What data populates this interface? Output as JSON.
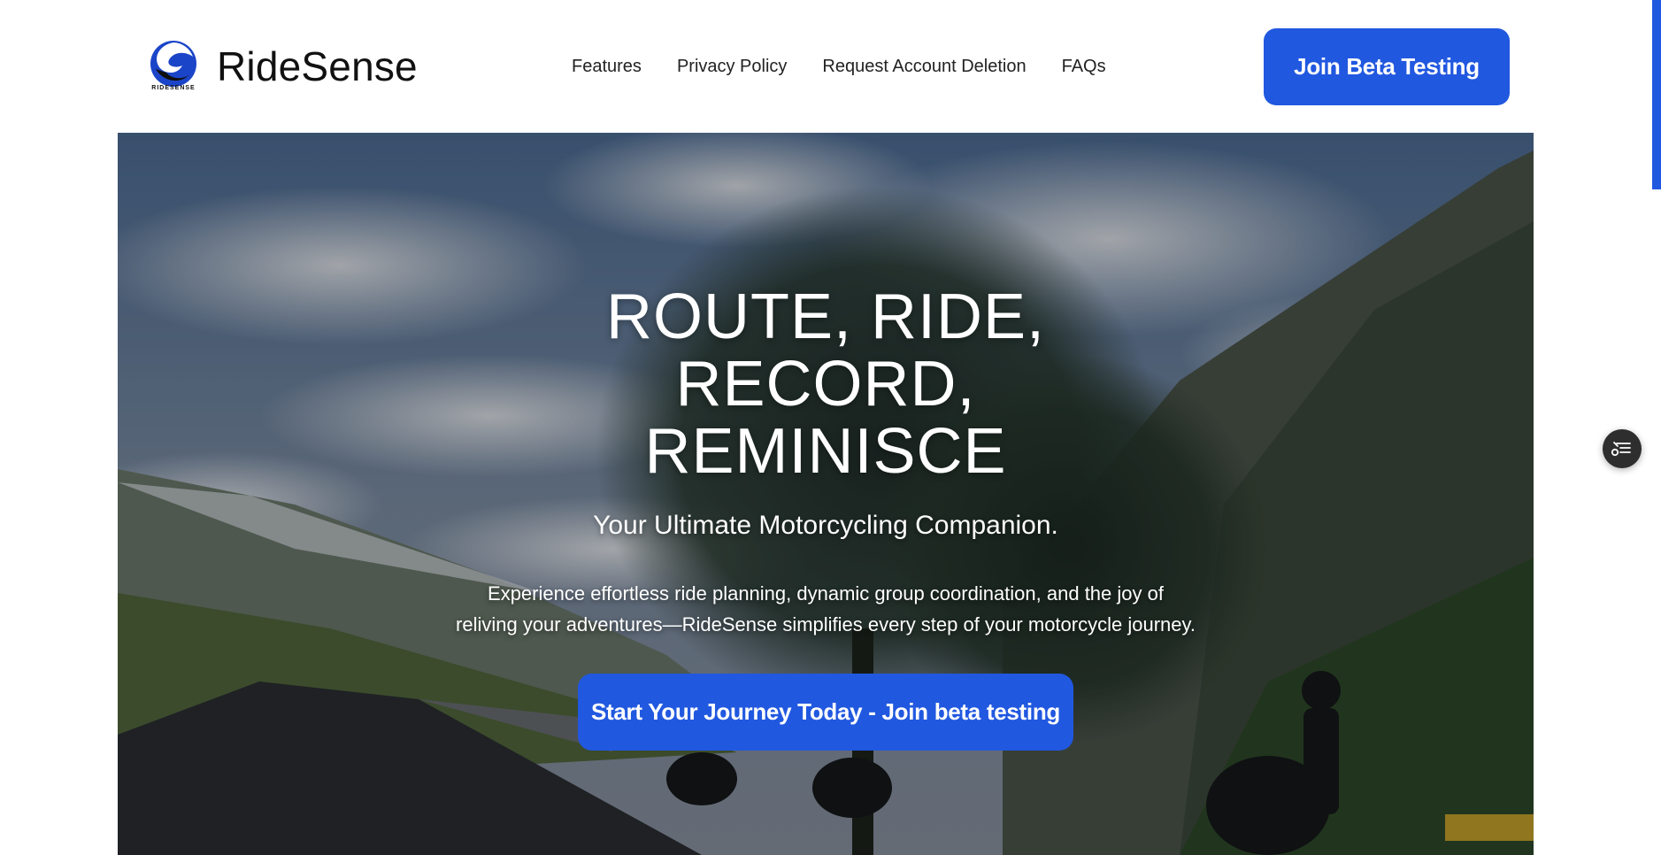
{
  "header": {
    "logo_icon": "ridesense-swirl-logo",
    "logo_small_text": "RIDESENSE",
    "brand_name": "RideSense",
    "nav": [
      {
        "label": "Features"
      },
      {
        "label": "Privacy Policy"
      },
      {
        "label": "Request Account Deletion"
      },
      {
        "label": "FAQs"
      }
    ],
    "cta_label": "Join Beta Testing"
  },
  "hero": {
    "headline_lines": [
      "ROUTE, RIDE,",
      "RECORD,",
      "REMINISCE"
    ],
    "tagline": "Your Ultimate Motorcycling Companion.",
    "description_lines": [
      "Experience effortless ride planning, dynamic group coordination, and the joy of",
      "reliving your adventures—RideSense simplifies every step of your motorcycle journey."
    ],
    "cta_label": "Start Your Journey Today - Join beta testing",
    "background": "mountain-road-with-motorcycles-photo"
  },
  "widgets": {
    "floating_icon": "accessibility-menu-icon"
  },
  "colors": {
    "accent": "#2158e0",
    "text_dark": "#111111",
    "hero_text": "#ffffff"
  }
}
